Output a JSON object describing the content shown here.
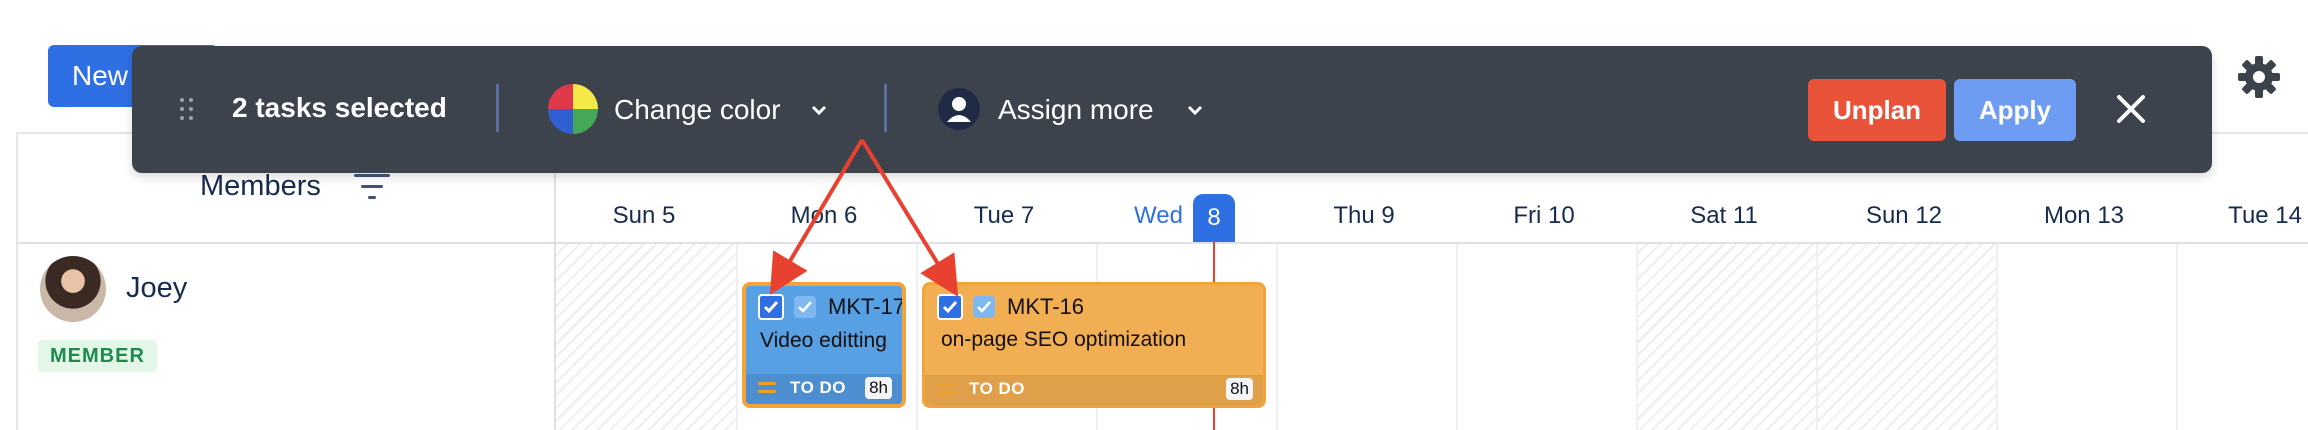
{
  "header": {
    "new_button_label": "New",
    "settings_icon": "gear-icon"
  },
  "toolbar": {
    "selected_count_text": "2 tasks selected",
    "change_color_label": "Change color",
    "assign_more_label": "Assign more",
    "unplan_label": "Unplan",
    "apply_label": "Apply",
    "colors": {
      "background": "#3d434c",
      "unplan": "#e8533a",
      "apply": "#6f9cf3"
    }
  },
  "calendar": {
    "members_header": "Members",
    "days": [
      {
        "label": "Sun 5",
        "weekend": true
      },
      {
        "label": "Mon 6",
        "weekend": false
      },
      {
        "label": "Tue 7",
        "weekend": false
      },
      {
        "label": "Wed",
        "today_number": "8",
        "weekend": false,
        "today": true
      },
      {
        "label": "Thu 9",
        "weekend": false
      },
      {
        "label": "Fri 10",
        "weekend": false
      },
      {
        "label": "Sat 11",
        "weekend": true
      },
      {
        "label": "Sun 12",
        "weekend": true
      },
      {
        "label": "Mon 13",
        "weekend": false
      },
      {
        "label": "Tue 14",
        "weekend": false
      }
    ]
  },
  "members": [
    {
      "name": "Joey",
      "role": "MEMBER",
      "tasks": [
        {
          "key": "MKT-17",
          "title": "Video editting",
          "status": "TO DO",
          "hours": "8h",
          "selected": true,
          "color": "#57a0e3"
        },
        {
          "key": "MKT-16",
          "title": "on-page SEO optimization",
          "status": "TO DO",
          "hours": "8h",
          "selected": true,
          "color": "#f2ae52"
        }
      ]
    }
  ]
}
